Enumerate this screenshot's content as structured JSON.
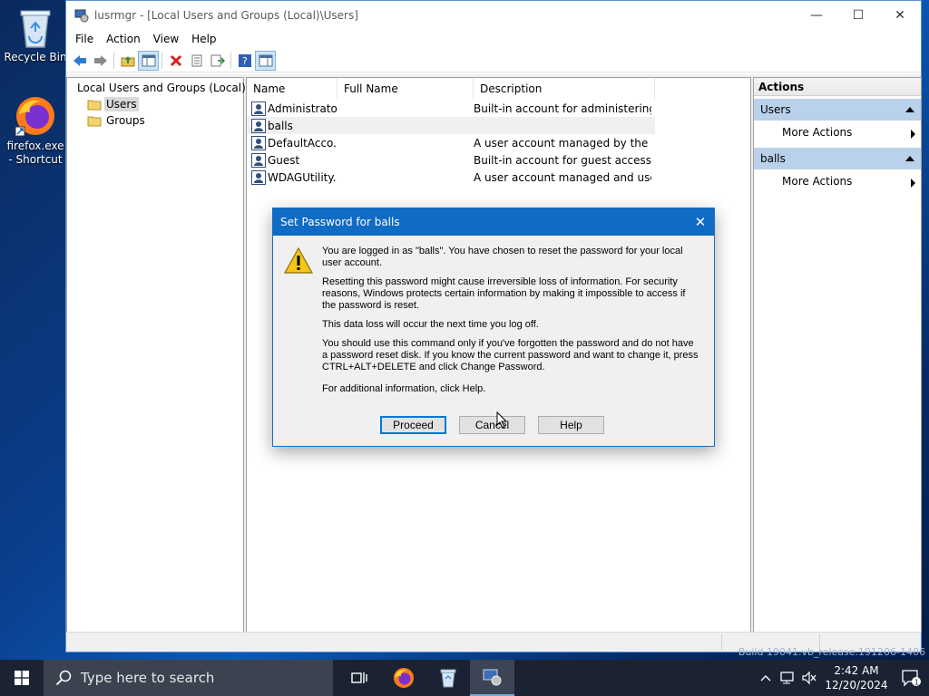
{
  "desktop": {
    "icons": [
      {
        "label": "Recycle Bin"
      },
      {
        "label": "firefox.exe - Shortcut"
      }
    ],
    "watermark": "Build 19041.vb_release.191206-1406"
  },
  "window": {
    "title": "lusrmgr - [Local Users and Groups (Local)\\Users]",
    "menu": [
      "File",
      "Action",
      "View",
      "Help"
    ],
    "tree": {
      "root": "Local Users and Groups (Local)",
      "children": [
        "Users",
        "Groups"
      ]
    },
    "list": {
      "columns": [
        "Name",
        "Full Name",
        "Description"
      ],
      "rows": [
        {
          "name": "Administrator",
          "full_name": "",
          "description": "Built-in account for administering..."
        },
        {
          "name": "balls",
          "full_name": "",
          "description": ""
        },
        {
          "name": "DefaultAcco...",
          "full_name": "",
          "description": "A user account managed by the s..."
        },
        {
          "name": "Guest",
          "full_name": "",
          "description": "Built-in account for guest access t..."
        },
        {
          "name": "WDAGUtility...",
          "full_name": "",
          "description": "A user account managed and use..."
        }
      ]
    },
    "actions": {
      "title": "Actions",
      "sections": [
        {
          "label": "Users",
          "item": "More Actions"
        },
        {
          "label": "balls",
          "item": "More Actions"
        }
      ]
    }
  },
  "dialog": {
    "title": "Set Password for balls",
    "paragraphs": [
      "You are logged in as \"balls\". You have chosen to reset the password for your local user account.",
      "Resetting this password might cause irreversible loss of information. For security reasons, Windows protects certain information by making it impossible to access if the password is reset.",
      "This data loss will occur the next time you log off.",
      "You should use this command only if you've forgotten the password and do not have a password reset disk. If you know the current password and want to change it, press CTRL+ALT+DELETE and click Change Password.",
      "For additional information, click Help."
    ],
    "buttons": {
      "proceed": "Proceed",
      "cancel": "Cancel",
      "help": "Help"
    }
  },
  "taskbar": {
    "search_placeholder": "Type here to search",
    "time": "2:42 AM",
    "date": "12/20/2024",
    "notification_count": "1"
  },
  "colors": {
    "dialog_title": "#0f6bc4",
    "action_section": "#b9d1ea",
    "taskbar": "#1b2333"
  }
}
